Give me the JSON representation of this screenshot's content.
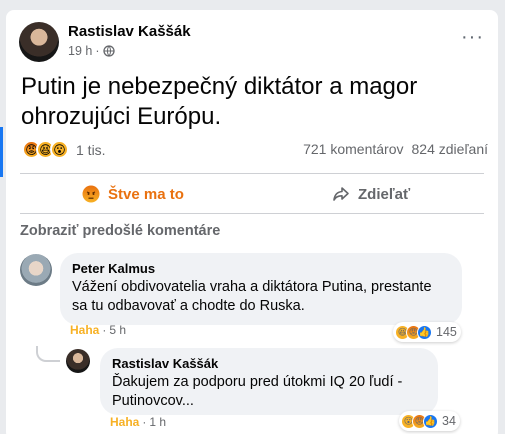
{
  "post": {
    "author": "Rastislav Kaššák",
    "time": "19 h",
    "separator": "·",
    "text": "Putin je nebezpečný diktátor a magor ohrozujúci Európu.",
    "reaction_count": "1 tis.",
    "comments_count": "721 komentárov",
    "shares_count": "824 zdieľaní"
  },
  "actions": {
    "react_label": "Štve ma to",
    "share_label": "Zdieľať"
  },
  "comments_section": {
    "previous_label": "Zobraziť predošlé komentáre"
  },
  "comments": [
    {
      "author": "Peter Kalmus",
      "text": "Vážení obdivovatelia vraha a diktátora Putina, prestante sa tu odbavovať a chodte do Ruska.",
      "reaction_label": "Haha",
      "time": "5 h",
      "reaction_total": "145"
    },
    {
      "author": "Rastislav Kaššák",
      "text": "Ďakujem za podporu pred útokmi IQ 20 ľudí - Putinovcov...",
      "reaction_label": "Haha",
      "time": "1 h",
      "reaction_total": "34"
    }
  ],
  "icons": {
    "reactions_post": [
      "angry-emoji-icon",
      "haha-emoji-icon",
      "wow-emoji-icon"
    ],
    "comment1_reactions": [
      "haha-emoji-icon",
      "angry-emoji-icon",
      "like-icon"
    ],
    "comment2_reactions": [
      "wow-emoji-icon",
      "angry-emoji-icon",
      "like-icon"
    ],
    "privacy": "globe-icon",
    "menu": "more-options-icon",
    "share": "share-arrow-icon"
  },
  "colors": {
    "accent_blue": "#1877f2",
    "angry_orange": "#e9710f",
    "haha_yellow": "#f7b125",
    "secondary_text": "#65676b",
    "bubble_bg": "#f0f2f5"
  }
}
